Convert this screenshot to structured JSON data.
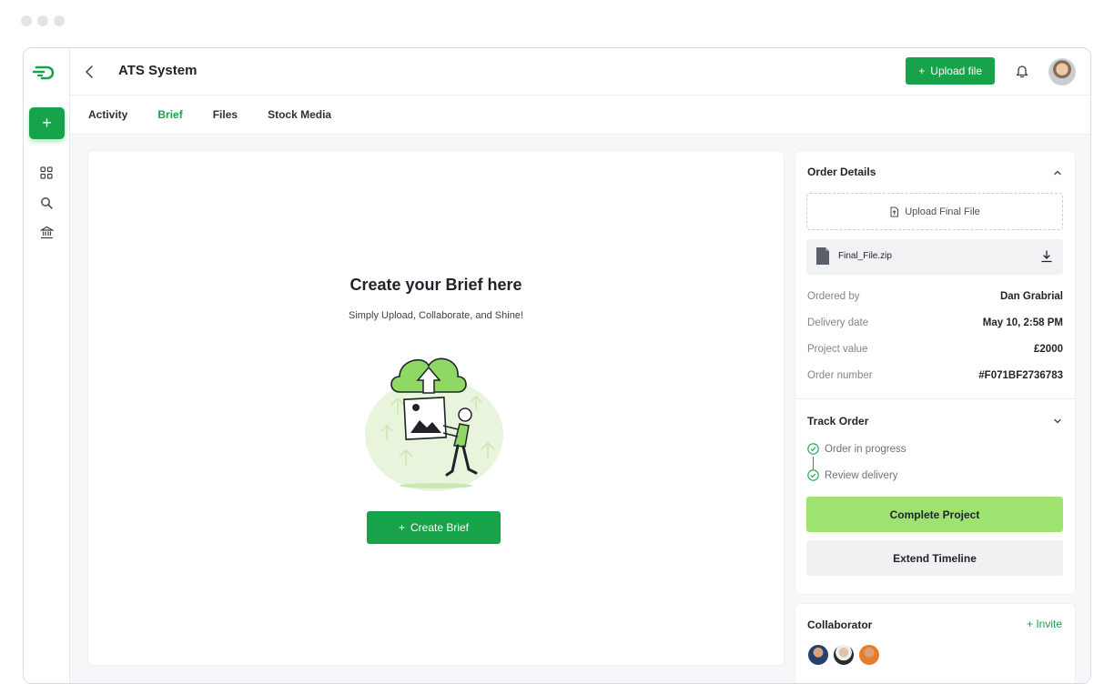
{
  "header": {
    "title": "ATS System",
    "upload_label": "Upload file"
  },
  "tabs": [
    {
      "label": "Activity",
      "active": false
    },
    {
      "label": "Brief",
      "active": true
    },
    {
      "label": "Files",
      "active": false
    },
    {
      "label": "Stock Media",
      "active": false
    }
  ],
  "rail": {
    "plus_label": "+",
    "icons": [
      "grid-icon",
      "search-icon",
      "bank-icon"
    ]
  },
  "brief": {
    "title": "Create your Brief here",
    "subtitle": "Simply Upload, Collaborate, and Shine!",
    "button_label": "Create Brief"
  },
  "order": {
    "title": "Order Details",
    "upload_final_label": "Upload Final File",
    "file_name": "Final_File.zip",
    "fields": [
      {
        "key": "Ordered by",
        "value": "Dan Grabrial"
      },
      {
        "key": "Delivery date",
        "value": "May 10, 2:58 PM"
      },
      {
        "key": "Project value",
        "value": "£2000"
      },
      {
        "key": "Order number",
        "value": "#F071BF2736783"
      }
    ]
  },
  "track": {
    "title": "Track Order",
    "steps": [
      "Order in progress",
      "Review delivery"
    ],
    "complete_label": "Complete Project",
    "extend_label": "Extend Timeline"
  },
  "collab": {
    "title": "Collaborator",
    "invite_label": "Invite"
  },
  "colors": {
    "accent": "#16a34a",
    "complete": "#9ee36f",
    "illustration": "#e8f5dc"
  }
}
